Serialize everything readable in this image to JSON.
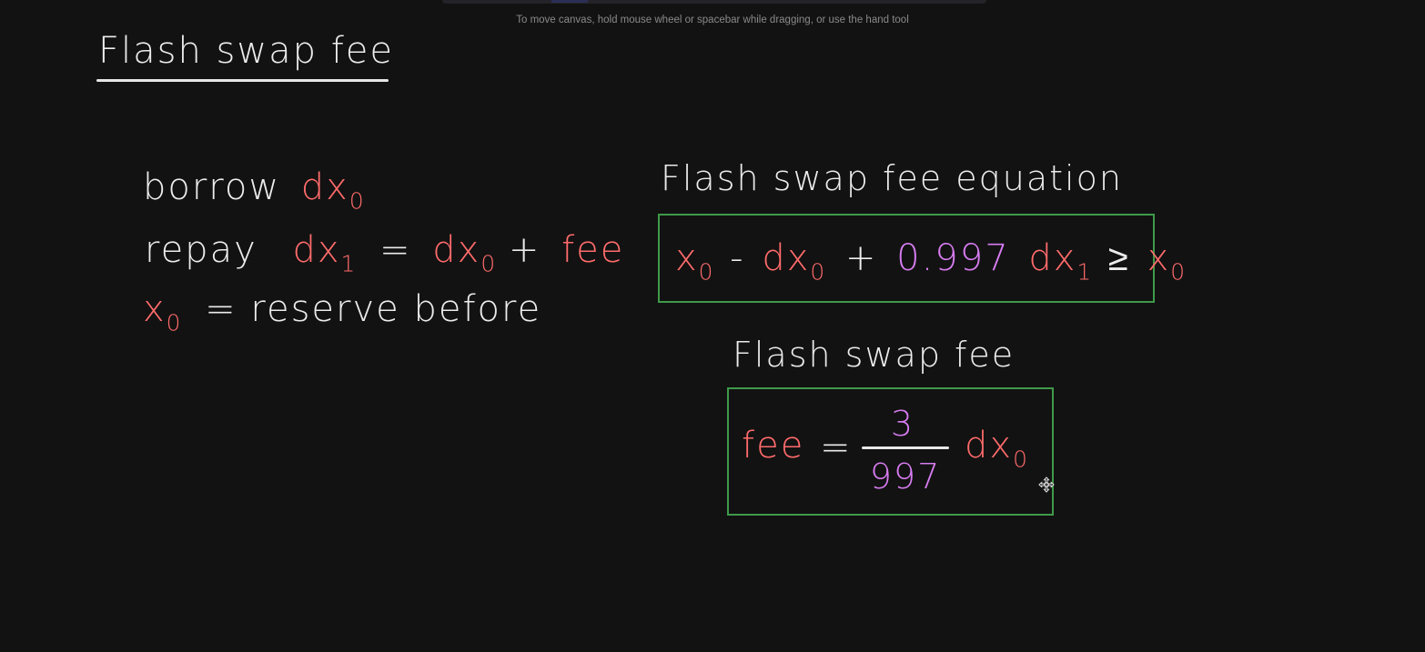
{
  "canvas": {
    "hint": "To move canvas, hold mouse wheel or spacebar while dragging, or use the hand tool",
    "background": "#121212"
  },
  "colors": {
    "text": "#ececec",
    "variable": "#ff6b6b",
    "number": "#d77cf0",
    "box_border": "#3f9a4a"
  },
  "title": "Flash swap fee",
  "left": {
    "borrow": {
      "word": "borrow",
      "var": "dx",
      "sub": "0"
    },
    "repay": {
      "word": "repay",
      "lhs_var": "dx",
      "lhs_sub": "1",
      "eq": "=",
      "rhs_var": "dx",
      "rhs_sub": "0",
      "plus": "+",
      "fee": "fee"
    },
    "reserve": {
      "var": "x",
      "sub": "0",
      "rest": "= reserve before"
    }
  },
  "right": {
    "equation_heading": "Flash swap fee equation",
    "equation": {
      "x": "x",
      "x_sub": "0",
      "minus": "-",
      "dx": "dx",
      "dx_sub": "0",
      "plus": "+",
      "coef": "0.997",
      "dx1": "dx",
      "dx1_sub": "1",
      "geq": "≥",
      "x_rhs": "x",
      "x_rhs_sub": "0"
    },
    "fee_heading": "Flash swap fee",
    "fee_formula": {
      "lhs": "fee",
      "eq": "=",
      "numerator": "3",
      "denominator": "997",
      "var": "dx",
      "sub": "0"
    }
  },
  "cursor_icon": "move-cursor-icon"
}
